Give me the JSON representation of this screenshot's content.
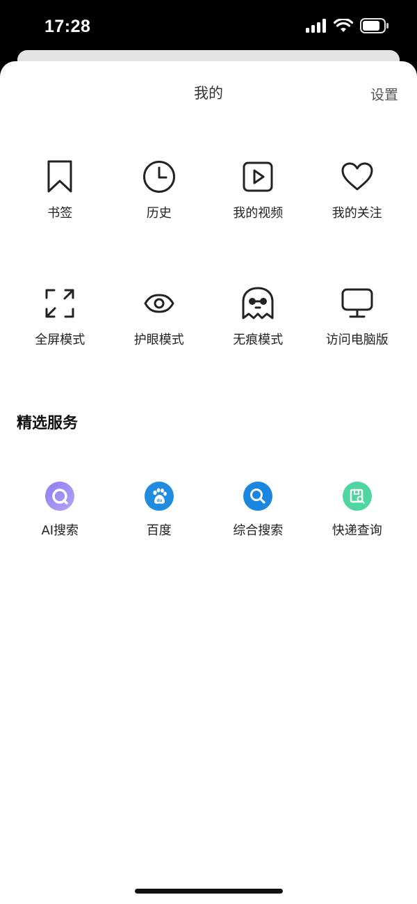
{
  "status_bar": {
    "time": "17:28"
  },
  "header": {
    "title": "我的",
    "settings_label": "设置"
  },
  "menu_row1": [
    {
      "label": "书签",
      "icon": "bookmark-icon"
    },
    {
      "label": "历史",
      "icon": "clock-icon"
    },
    {
      "label": "我的视频",
      "icon": "video-icon"
    },
    {
      "label": "我的关注",
      "icon": "heart-icon"
    }
  ],
  "menu_row2": [
    {
      "label": "全屏模式",
      "icon": "fullscreen-icon"
    },
    {
      "label": "护眼模式",
      "icon": "eye-icon"
    },
    {
      "label": "无痕模式",
      "icon": "ghost-icon"
    },
    {
      "label": "访问电脑版",
      "icon": "monitor-icon"
    }
  ],
  "services": {
    "title": "精选服务",
    "items": [
      {
        "label": "AI搜索",
        "icon": "ai-search-icon",
        "color": "#9b8cf0"
      },
      {
        "label": "百度",
        "icon": "baidu-paw-icon",
        "color": "#1f8ce0"
      },
      {
        "label": "综合搜索",
        "icon": "search-icon",
        "color": "#1a86e0"
      },
      {
        "label": "快递查询",
        "icon": "package-search-icon",
        "color": "#4fd6a0"
      }
    ]
  }
}
